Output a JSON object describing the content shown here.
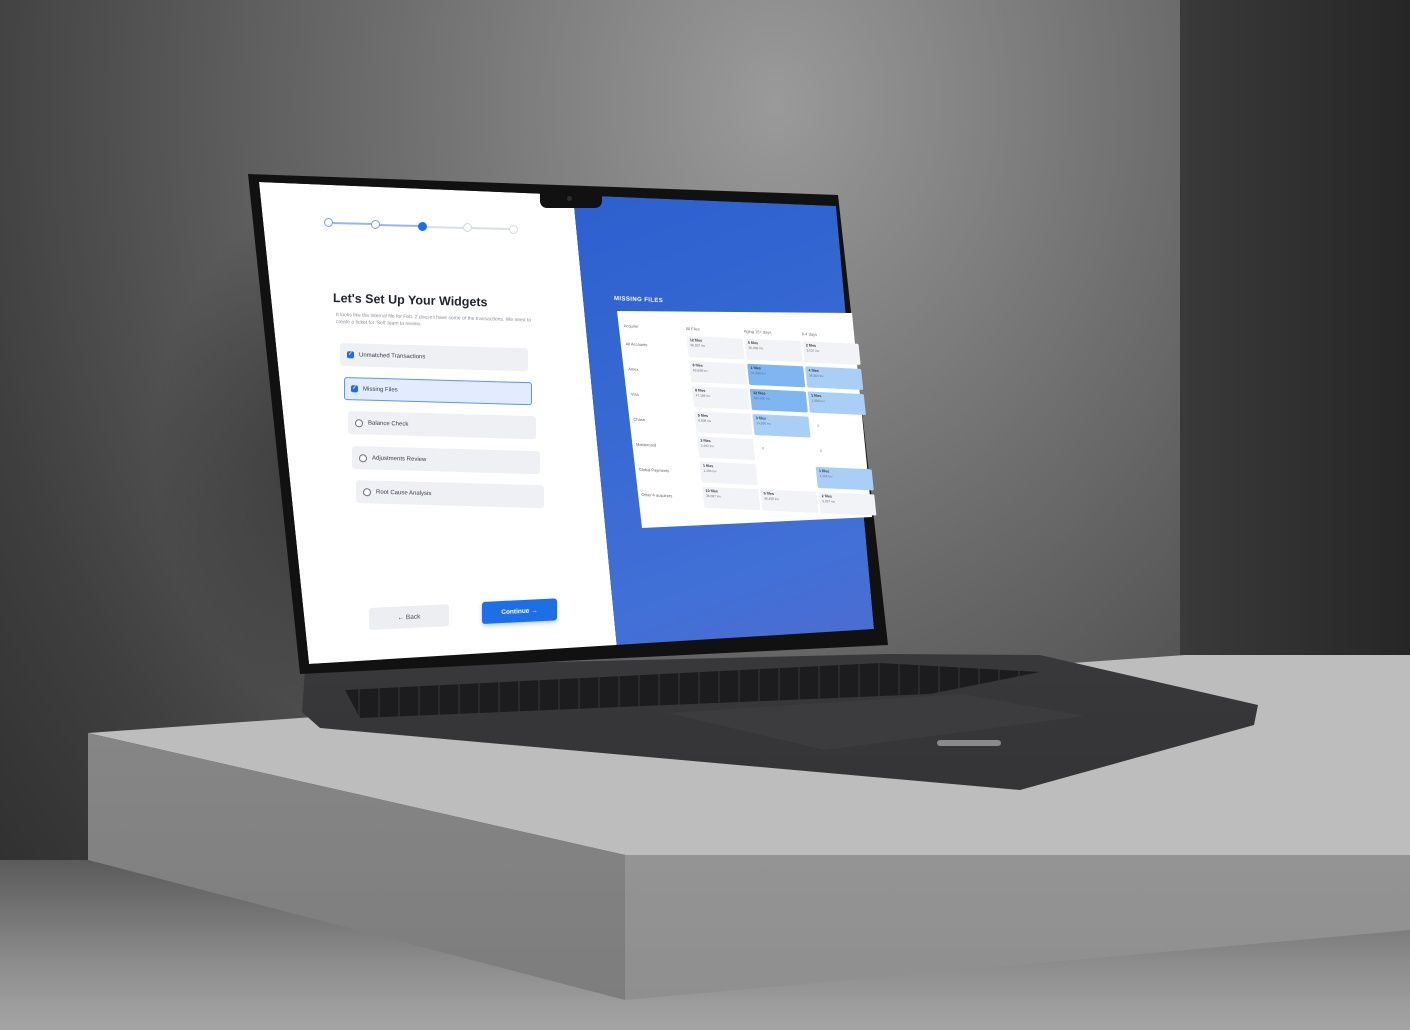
{
  "stepper": {
    "total": 5,
    "current": 3
  },
  "setup": {
    "title": "Let's Set Up Your Widgets",
    "subtitle": "It looks like the internal file for Feb. 2 doesn't have some of the transactions. We need to create a ticket for 'Sell' team to review.",
    "options": [
      {
        "label": "Unmatched Transactions",
        "checked": true,
        "selected": false
      },
      {
        "label": "Missing Files",
        "checked": true,
        "selected": true
      },
      {
        "label": "Balance Check",
        "checked": false,
        "selected": false
      },
      {
        "label": "Adjustments Review",
        "checked": false,
        "selected": false
      },
      {
        "label": "Root Cause Analysis",
        "checked": false,
        "selected": false
      }
    ],
    "back_label": "← Back",
    "continue_label": "Continue →"
  },
  "missing_files": {
    "title": "MISSING FILES",
    "columns": [
      "Acquirer",
      "All Files",
      "Aging 15+ days",
      "8-4 days"
    ],
    "rows": [
      {
        "label": "All Accounts",
        "cells": [
          [
            "12 files",
            "36,097 inv"
          ],
          [
            "5 files",
            "36,458 inv"
          ],
          [
            "2 files",
            "3,037 inv"
          ]
        ]
      },
      {
        "label": "Amex",
        "cells": [
          [
            "8 files",
            "63,838 inv"
          ],
          [
            "1 files",
            "94,300 inv"
          ],
          [
            "4 files",
            "38,904 inv"
          ]
        ]
      },
      {
        "label": "Visa",
        "cells": [
          [
            "8 files",
            "47,188 inv"
          ],
          [
            "12 files",
            "184,300 inv"
          ],
          [
            "1 files",
            "1,989 inv"
          ]
        ]
      },
      {
        "label": "Chase",
        "cells": [
          [
            "5 files",
            "6,808 inv"
          ],
          [
            "3 files",
            "14,990 inv"
          ],
          [
            "0",
            ""
          ]
        ]
      },
      {
        "label": "Mastercard",
        "cells": [
          [
            "3 files",
            "2,942 inv"
          ],
          [
            "0",
            ""
          ],
          [
            "0",
            ""
          ]
        ]
      },
      {
        "label": "Global Payments",
        "cells": [
          [
            "1 files",
            "1,204 inv"
          ],
          [
            "",
            ""
          ],
          [
            "1 files",
            "1,204 inv"
          ]
        ]
      },
      {
        "label": "Other 4 acquirers",
        "cells": [
          [
            "10 files",
            "36,097 inv"
          ],
          [
            "5 files",
            "36,458 inv"
          ],
          [
            "2 files",
            "3,037 inv"
          ]
        ]
      }
    ]
  },
  "colors": {
    "accent": "#1e6fe5",
    "highlight": "#a9cff7",
    "gradient_start": "#2a4fb8",
    "gradient_end": "#5940b8"
  }
}
